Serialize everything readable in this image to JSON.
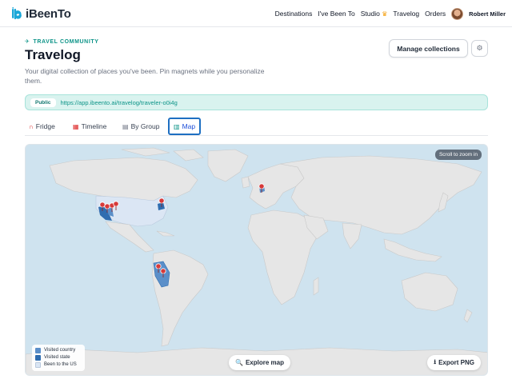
{
  "nav": {
    "logo": "iBeenTo",
    "links": [
      "Destinations",
      "I've Been To",
      "Studio",
      "Travelog",
      "Orders"
    ],
    "user_name": "Robert Miller"
  },
  "header": {
    "eyebrow": "TRAVEL COMMUNITY",
    "title": "Travelog",
    "subtitle": "Your digital collection of places you've been. Pin magnets while you personalize them.",
    "manage_label": "Manage collections"
  },
  "public": {
    "badge": "Public",
    "url": "https://app.ibeento.ai/travelog/traveler-o0i4g"
  },
  "tabs": [
    {
      "label": "Fridge",
      "icon": "magnet-icon"
    },
    {
      "label": "Timeline",
      "icon": "calendar-icon"
    },
    {
      "label": "By Group",
      "icon": "grid-icon"
    },
    {
      "label": "Map",
      "icon": "map-icon"
    }
  ],
  "active_tab": "Map",
  "map": {
    "scroll_hint": "Scroll to zoom in",
    "legend": [
      "Visited country",
      "Visited state",
      "Been to the US"
    ],
    "explore_label": "Explore map",
    "export_label": "Export PNG"
  },
  "colors": {
    "accent": "#0d9488",
    "water": "#cfe3ef",
    "land": "#e6e6e6",
    "visited_country": "#5b8fc9",
    "visited_state": "#2f6db0",
    "been_us": "#dbe6f4",
    "pin": "#d63a3a",
    "active_tab": "#1e6fc2"
  }
}
